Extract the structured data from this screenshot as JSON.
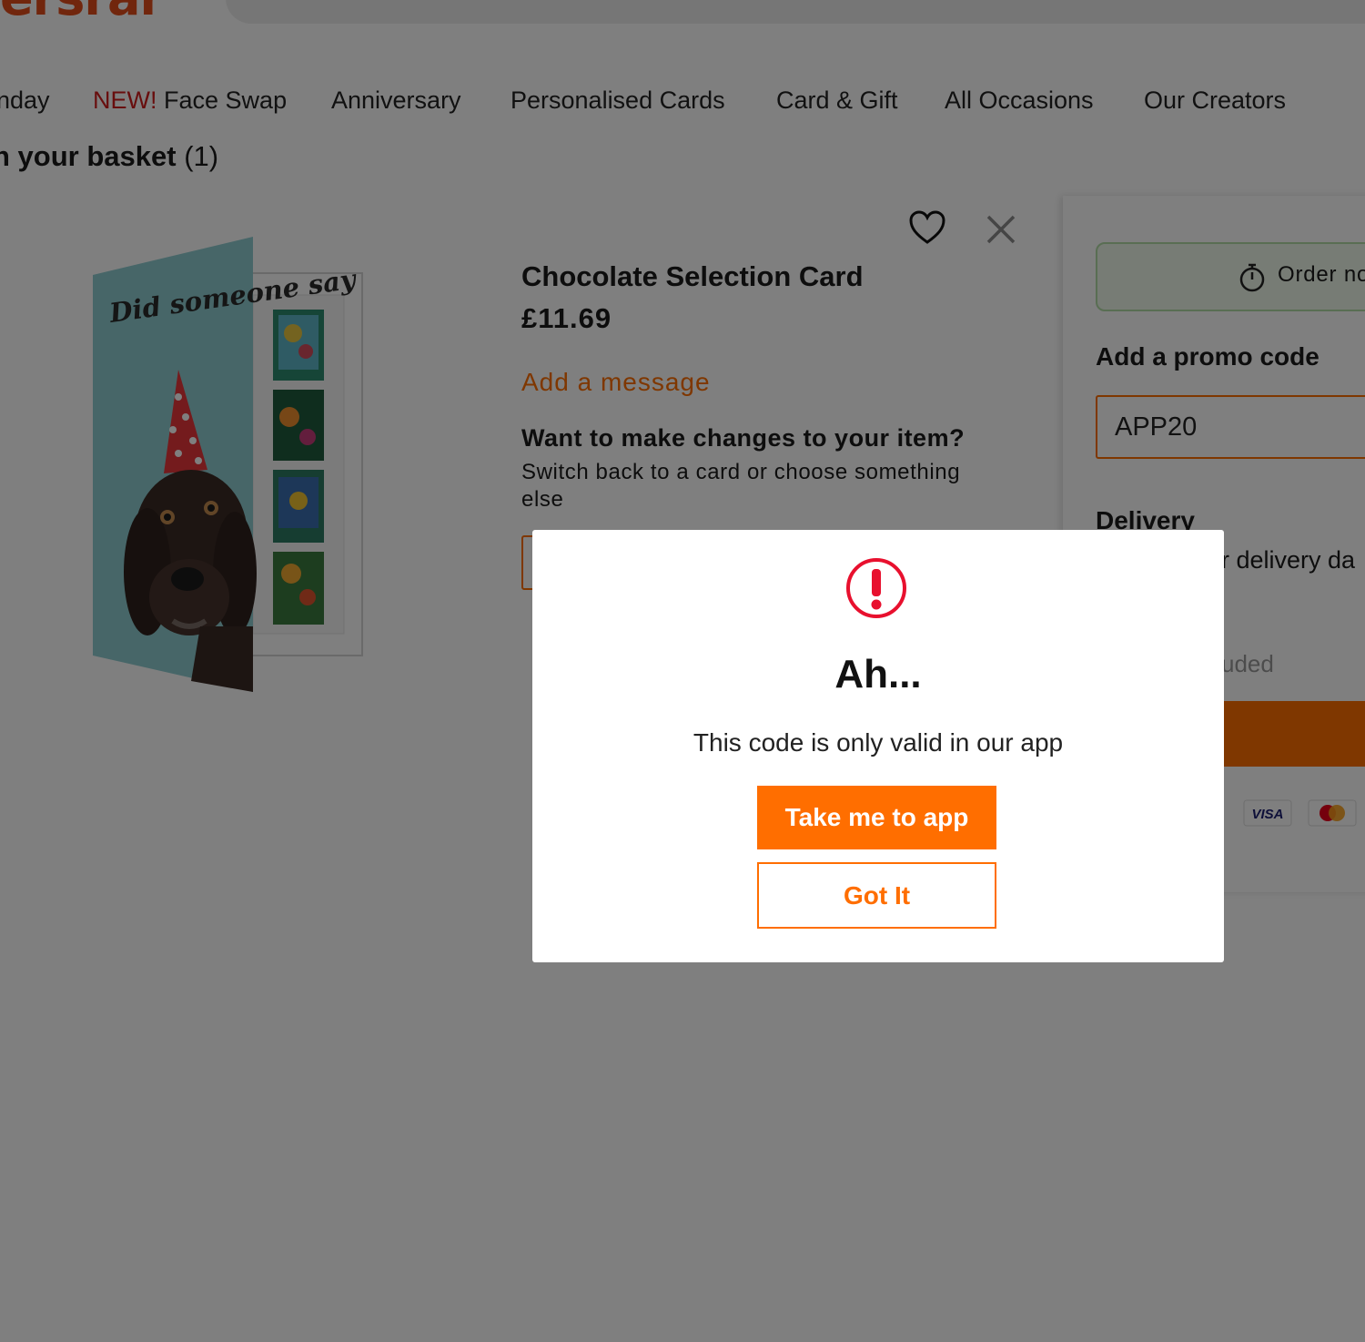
{
  "header": {
    "logo_text": "ersrar"
  },
  "nav": {
    "items": [
      {
        "label": "nday"
      },
      {
        "new_badge": "NEW!",
        "label": "Face Swap"
      },
      {
        "label": "Anniversary"
      },
      {
        "label": "Personalised Cards"
      },
      {
        "label": "Card & Gift"
      },
      {
        "label": "All Occasions"
      },
      {
        "label": "Our Creators"
      }
    ]
  },
  "basket": {
    "title": "n your basket",
    "count": "(1)"
  },
  "product": {
    "image_text": "Did someone say cake?",
    "name": "Chocolate Selection Card",
    "price": "£11.69",
    "add_message": "Add a message",
    "changes_title": "Want to make changes to your item?",
    "changes_sub": "Switch back to a card or choose something else"
  },
  "summary": {
    "order_notice": "Order no",
    "promo_title": "Add a promo code",
    "promo_value": "APP20",
    "delivery_title": "Delivery",
    "delivery_text": "r delivery da",
    "vat_text": "uded",
    "payment_icons": [
      "visa-icon",
      "mastercard-icon"
    ]
  },
  "modal": {
    "icon": "alert-icon",
    "title": "Ah...",
    "message": "This code is only valid in our app",
    "primary_button": "Take me to app",
    "secondary_button": "Got It"
  },
  "colors": {
    "accent": "#ff6e00",
    "new_badge": "#d11c1c",
    "alert": "#e8102e",
    "overlay": "rgba(0,0,0,0.5)"
  }
}
